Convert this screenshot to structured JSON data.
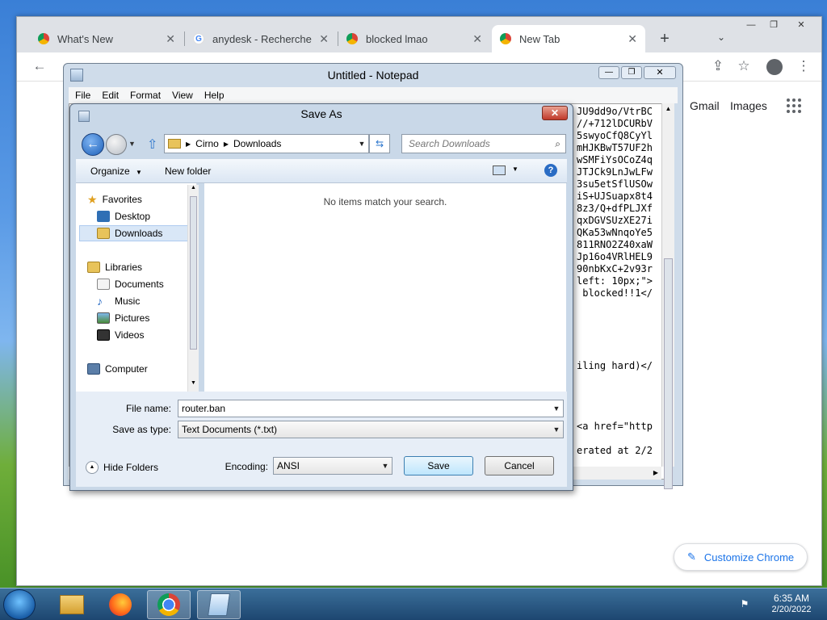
{
  "chrome": {
    "tabs": [
      {
        "label": "What's New",
        "icon": "chrome-icon"
      },
      {
        "label": "anydesk - Recherche G",
        "icon": "google-icon"
      },
      {
        "label": "blocked lmao",
        "icon": "chrome-icon"
      },
      {
        "label": "New Tab",
        "icon": "chrome-icon"
      }
    ],
    "new_tab_label": "+",
    "gmail": "Gmail",
    "images": "Images",
    "customize": "Customize Chrome"
  },
  "notepad": {
    "title": "Untitled - Notepad",
    "menu": [
      "File",
      "Edit",
      "Format",
      "View",
      "Help"
    ],
    "lines": [
      "JU9dd9o/VtrBC",
      "//+712lDCURbV",
      "5swyoCfQ8CyYl",
      "mHJKBwT57UF2h",
      "wSMFiYsOCoZ4q",
      "JTJCk9LnJwLFw",
      "3su5etSflUSOw",
      "iS+UJSuapx8t4",
      "8z3/Q+dfPLJXf",
      "qxDGVSUzXE27i",
      "QKa53wNnqoYe5",
      "811RNO2Z40xaW",
      "Jp16o4VRlHEL9",
      "90nbKxC+2v93r",
      "left: 10px;\">",
      " blocked!!1</",
      "",
      "",
      "",
      "",
      "",
      "iling hard)</",
      "",
      "",
      "",
      "",
      "<a href=\"http",
      "",
      "erated at 2/2"
    ]
  },
  "dialog": {
    "title": "Save As",
    "breadcrumb": [
      "Cirno",
      "Downloads"
    ],
    "search_placeholder": "Search Downloads",
    "organize": "Organize",
    "new_folder": "New folder",
    "empty_message": "No items match your search.",
    "nav": {
      "favorites": "Favorites",
      "desktop": "Desktop",
      "downloads": "Downloads",
      "libraries": "Libraries",
      "documents": "Documents",
      "music": "Music",
      "pictures": "Pictures",
      "videos": "Videos",
      "computer": "Computer"
    },
    "file_name_label": "File name:",
    "file_name_value": "router.ban",
    "save_type_label": "Save as type:",
    "save_type_value": "Text Documents (*.txt)",
    "encoding_label": "Encoding:",
    "encoding_value": "ANSI",
    "save": "Save",
    "cancel": "Cancel",
    "hide_folders": "Hide Folders"
  },
  "taskbar": {
    "time": "6:35 AM",
    "date": "2/20/2022"
  },
  "colors": {
    "chrome_link": "#1a73e8",
    "dialog_frame": "#c9d8e8",
    "taskbar": "#1d4670"
  }
}
